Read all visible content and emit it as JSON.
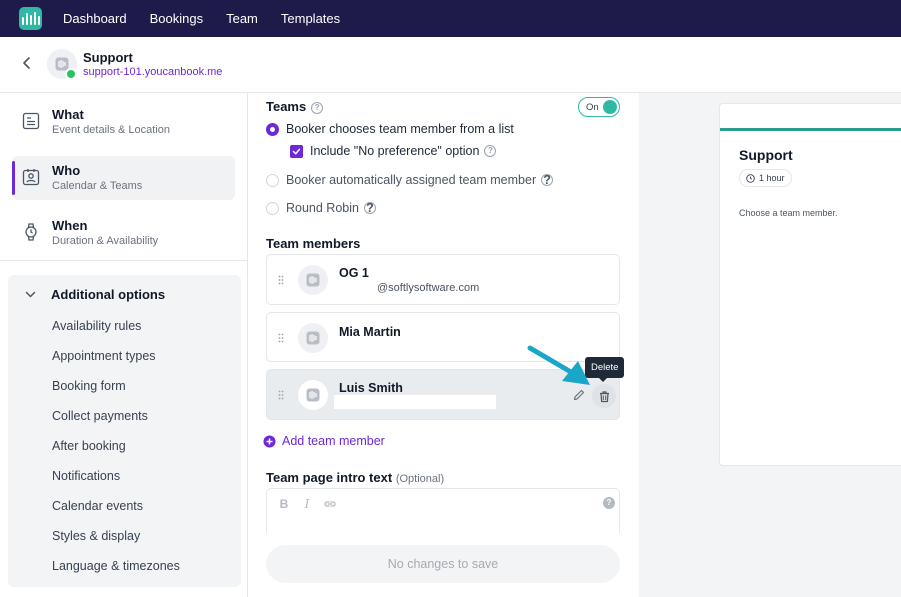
{
  "nav": {
    "items": [
      "Dashboard",
      "Bookings",
      "Team",
      "Templates"
    ]
  },
  "header": {
    "title": "Support",
    "url": "support-101.youcanbook.me"
  },
  "sidebar": {
    "steps": [
      {
        "title": "What",
        "subtitle": "Event details & Location"
      },
      {
        "title": "Who",
        "subtitle": "Calendar & Teams"
      },
      {
        "title": "When",
        "subtitle": "Duration & Availability"
      }
    ],
    "additional": {
      "title": "Additional options",
      "items": [
        "Availability rules",
        "Appointment types",
        "Booking form",
        "Collect payments",
        "After booking",
        "Notifications",
        "Calendar events",
        "Styles & display",
        "Language & timezones"
      ]
    }
  },
  "form": {
    "teams_label": "Teams",
    "toggle_label": "On",
    "options": {
      "choose": "Booker chooses team member from a list",
      "no_pref": "Include \"No preference\" option",
      "auto": "Booker automatically assigned team member",
      "round_robin": "Round Robin"
    },
    "members_label": "Team members",
    "members": [
      {
        "name": "OG 1",
        "email": "@softlysoftware.com"
      },
      {
        "name": "Mia Martin",
        "email": ""
      },
      {
        "name": "Luis Smith",
        "email": ""
      }
    ],
    "tooltip": "Delete",
    "add_member": "Add team member",
    "intro_label": "Team page intro text",
    "intro_optional": "(Optional)",
    "save_label": "No changes to save"
  },
  "preview": {
    "title": "Support",
    "duration": "1 hour",
    "description": "Choose a team member."
  },
  "colors": {
    "accent": "#6d28d9",
    "brand": "#2fb9a5",
    "nav_bg": "#1e1b4b",
    "arrow": "#1aa7c7"
  }
}
